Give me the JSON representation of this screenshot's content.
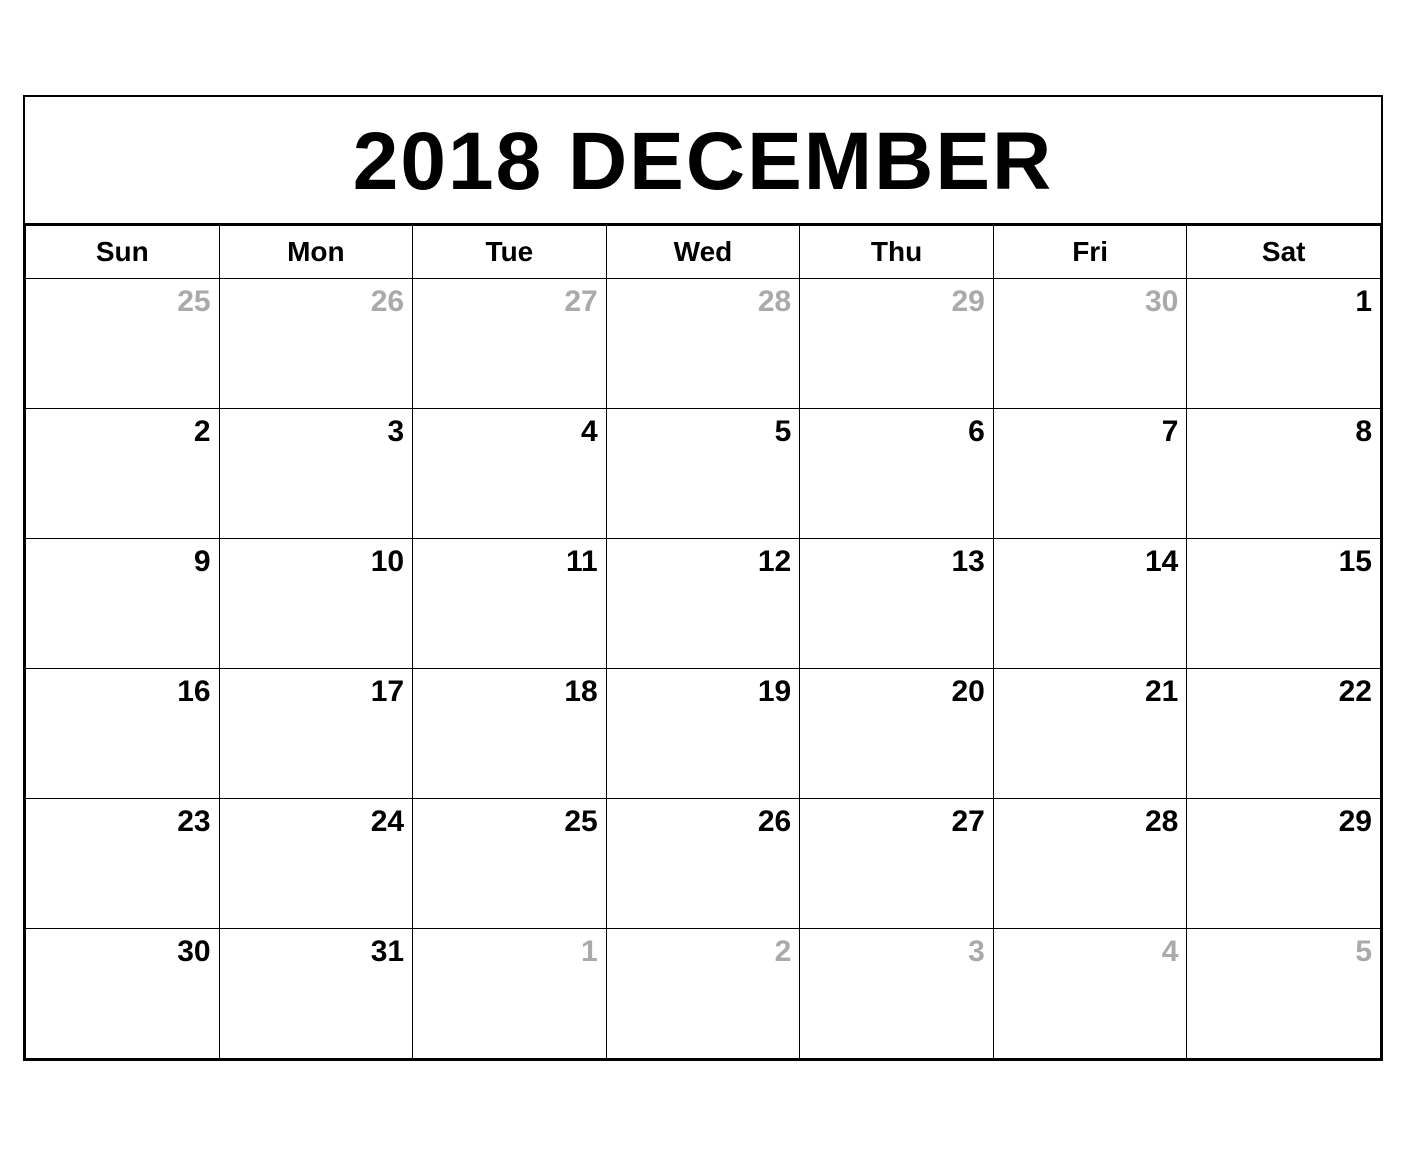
{
  "header": {
    "title": "2018 DECEMBER"
  },
  "days_of_week": [
    "Sun",
    "Mon",
    "Tue",
    "Wed",
    "Thu",
    "Fri",
    "Sat"
  ],
  "weeks": [
    [
      {
        "day": "25",
        "other": true
      },
      {
        "day": "26",
        "other": true
      },
      {
        "day": "27",
        "other": true
      },
      {
        "day": "28",
        "other": true
      },
      {
        "day": "29",
        "other": true
      },
      {
        "day": "30",
        "other": true
      },
      {
        "day": "1",
        "other": false
      }
    ],
    [
      {
        "day": "2",
        "other": false
      },
      {
        "day": "3",
        "other": false
      },
      {
        "day": "4",
        "other": false
      },
      {
        "day": "5",
        "other": false
      },
      {
        "day": "6",
        "other": false
      },
      {
        "day": "7",
        "other": false
      },
      {
        "day": "8",
        "other": false
      }
    ],
    [
      {
        "day": "9",
        "other": false
      },
      {
        "day": "10",
        "other": false
      },
      {
        "day": "11",
        "other": false
      },
      {
        "day": "12",
        "other": false
      },
      {
        "day": "13",
        "other": false
      },
      {
        "day": "14",
        "other": false
      },
      {
        "day": "15",
        "other": false
      }
    ],
    [
      {
        "day": "16",
        "other": false
      },
      {
        "day": "17",
        "other": false
      },
      {
        "day": "18",
        "other": false
      },
      {
        "day": "19",
        "other": false
      },
      {
        "day": "20",
        "other": false
      },
      {
        "day": "21",
        "other": false
      },
      {
        "day": "22",
        "other": false
      }
    ],
    [
      {
        "day": "23",
        "other": false
      },
      {
        "day": "24",
        "other": false
      },
      {
        "day": "25",
        "other": false
      },
      {
        "day": "26",
        "other": false
      },
      {
        "day": "27",
        "other": false
      },
      {
        "day": "28",
        "other": false
      },
      {
        "day": "29",
        "other": false
      }
    ],
    [
      {
        "day": "30",
        "other": false
      },
      {
        "day": "31",
        "other": false
      },
      {
        "day": "1",
        "other": true
      },
      {
        "day": "2",
        "other": true
      },
      {
        "day": "3",
        "other": true
      },
      {
        "day": "4",
        "other": true
      },
      {
        "day": "5",
        "other": true
      }
    ]
  ]
}
